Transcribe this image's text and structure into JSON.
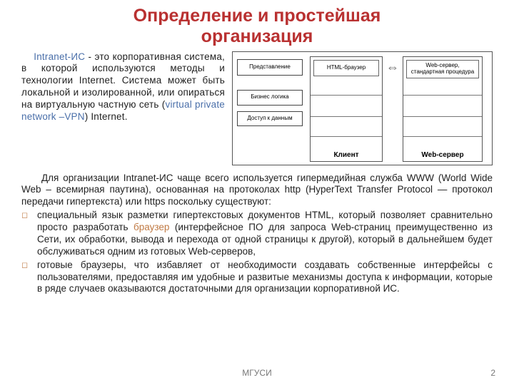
{
  "title_line1": "Определение и простейшая",
  "title_line2": "организация",
  "intro_lead": "Intranet-ИС",
  "intro_rest": " - это корпоративная система, в которой используются методы и технологии Internet. Система может быть локальной и изолированной, или опираться на виртуальную частную сеть (",
  "intro_vpn": "virtual private network –VPN",
  "intro_tail": ") Internet.",
  "diagram": {
    "layer1": "Представление",
    "layer2": "Бизнес логика",
    "layer3": "Доступ к данным",
    "client_box": "HTML-браузер",
    "server_box": "Web-сервер, стандартная процедура",
    "client_label": "Клиент",
    "server_label": "Web-сервер",
    "arrow": "⇔"
  },
  "para1": "Для организации Intranet-ИС чаще всего используется гипермедийная служба WWW (World Wide Web – всемирная паутина), основанная на протоколах http (HyperText Transfer Protocol — протокол передачи гипертекста) или https поскольку существуют:",
  "bullets": [
    {
      "pre": "специальный язык разметки гипертекстовых документов HTML, который позволяет сравнительно просто разработать ",
      "hl": "браузер",
      "post": " (интерфейсное ПО для запроса Web-страниц преимущественно из Сети, их обработки, вывода и перехода от одной страницы к другой), который в дальнейшем будет обслуживаться одним из готовых Web-серверов,"
    },
    {
      "pre": "готовые браузеры, что избавляет от необходимости создавать собственные интерфейсы с пользователями, предоставляя им удобные и развитые механизмы доступа к информации, которые в ряде случаев оказываются достаточными для организации корпоративной ИС.",
      "hl": "",
      "post": ""
    }
  ],
  "footer": "МГУСИ",
  "page": "2"
}
